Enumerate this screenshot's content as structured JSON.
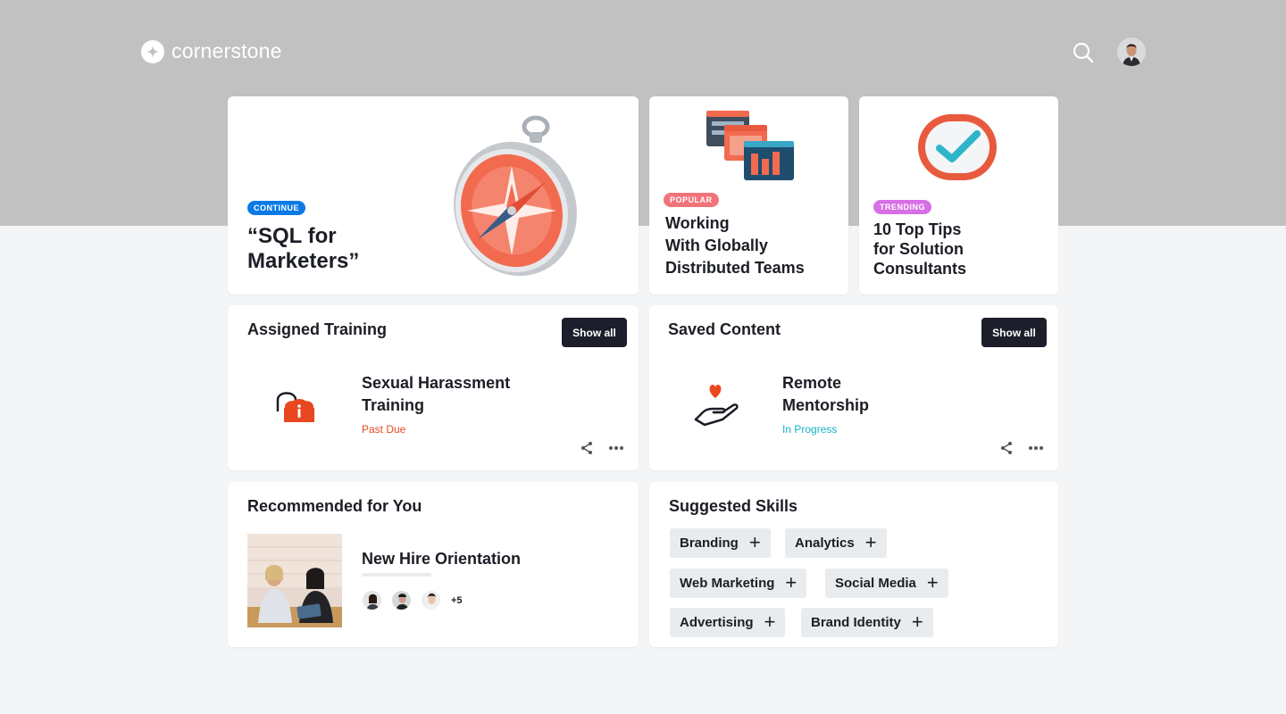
{
  "brand": {
    "name": "cornerstone"
  },
  "header": {
    "search_icon": "search-icon",
    "avatar": "user-avatar"
  },
  "hero": {
    "badge": "CONTINUE",
    "title_line1": "“SQL for",
    "title_line2": "Marketers”",
    "badge_color": "#0a7be6"
  },
  "tile_popular": {
    "badge": "POPULAR",
    "badge_color": "#f0737a",
    "title_lines": [
      "Working",
      "With Globally",
      "Distributed Teams"
    ]
  },
  "tile_trending": {
    "badge": "TRENDING",
    "badge_color": "#d76fe6",
    "title_lines": [
      "10 Top Tips",
      "for Solution",
      "Consultants"
    ]
  },
  "assigned": {
    "title": "Assigned Training",
    "show_all": "Show all",
    "item_lines": [
      "Sexual Harassment",
      "Training"
    ],
    "status": "Past Due",
    "status_color": "#e8471f",
    "icon": "alert-info-icon"
  },
  "saved": {
    "title": "Saved Content",
    "show_all": "Show all",
    "item_lines": [
      "Remote",
      "Mentorship"
    ],
    "status": "In Progress",
    "status_color": "#17b3c8",
    "icon": "hand-heart-icon"
  },
  "recommended": {
    "title": "Recommended for You",
    "item_title": "New Hire Orientation",
    "more_count": "+5"
  },
  "skills": {
    "title": "Suggested Skills",
    "items": [
      "Branding",
      "Analytics",
      "Web Marketing",
      "Social Media",
      "Advertising",
      "Brand Identity"
    ]
  }
}
